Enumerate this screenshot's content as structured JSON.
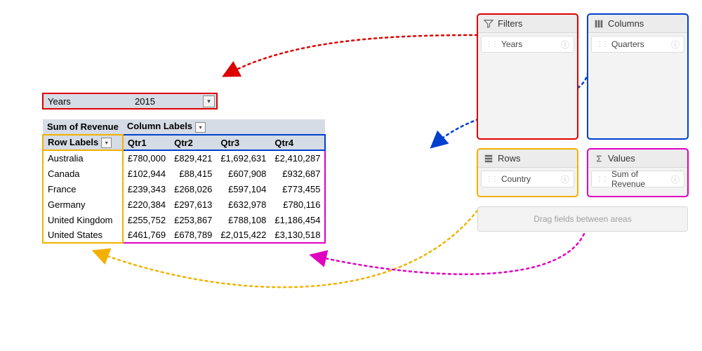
{
  "filter": {
    "label": "Years",
    "value": "2015"
  },
  "pivot": {
    "measure_label": "Sum of Revenue",
    "column_labels_label": "Column Labels",
    "row_labels_label": "Row Labels",
    "columns": [
      "Qtr1",
      "Qtr2",
      "Qtr3",
      "Qtr4"
    ],
    "rows": [
      {
        "label": "Australia",
        "values": [
          "£780,000",
          "£829,421",
          "£1,692,631",
          "£2,410,287"
        ]
      },
      {
        "label": "Canada",
        "values": [
          "£102,944",
          "£88,415",
          "£607,908",
          "£932,687"
        ]
      },
      {
        "label": "France",
        "values": [
          "£239,343",
          "£268,026",
          "£597,104",
          "£773,455"
        ]
      },
      {
        "label": "Germany",
        "values": [
          "£220,384",
          "£297,613",
          "£632,978",
          "£780,116"
        ]
      },
      {
        "label": "United Kingdom",
        "values": [
          "£255,752",
          "£253,867",
          "£788,108",
          "£1,186,454"
        ]
      },
      {
        "label": "United States",
        "values": [
          "£461,769",
          "£678,789",
          "£2,015,422",
          "£3,130,518"
        ]
      }
    ]
  },
  "areas": {
    "filters": {
      "title": "Filters",
      "field": "Years"
    },
    "columns": {
      "title": "Columns",
      "field": "Quarters"
    },
    "rows": {
      "title": "Rows",
      "field": "Country"
    },
    "values": {
      "title": "Values",
      "field": "Sum of Revenue"
    }
  },
  "hint": "Drag fields between areas"
}
